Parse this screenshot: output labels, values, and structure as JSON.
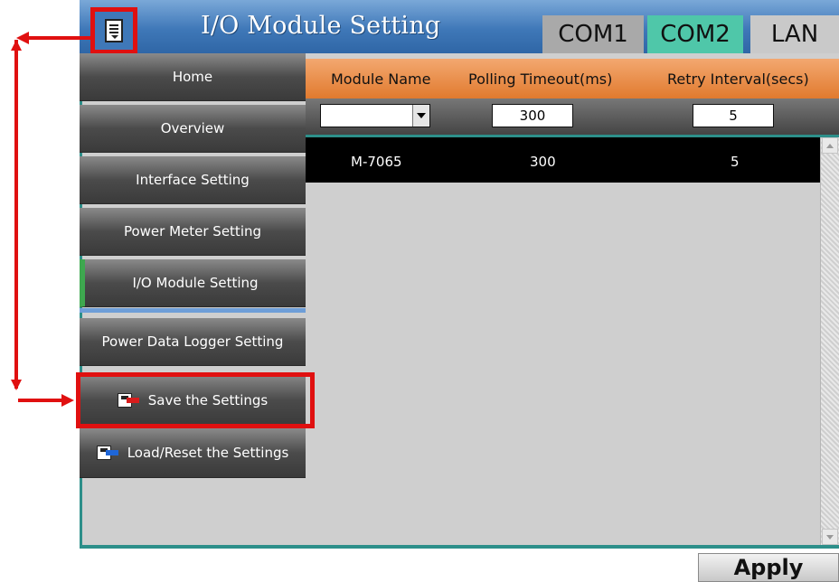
{
  "header": {
    "title": "I/O Module Setting",
    "menu_icon": "document-menu-icon",
    "tabs": [
      {
        "label": "COM1"
      },
      {
        "label": "COM2",
        "active": true
      },
      {
        "label": "LAN"
      }
    ]
  },
  "sidebar": {
    "items": [
      {
        "label": "Home"
      },
      {
        "label": "Overview"
      },
      {
        "label": "Interface Setting"
      },
      {
        "label": "Power Meter Setting"
      },
      {
        "label": "I/O Module Setting"
      },
      {
        "label": "Power Data Logger Setting"
      },
      {
        "label": "Save the Settings",
        "icon": "save-icon"
      },
      {
        "label": "Load/Reset the Settings",
        "icon": "load-icon"
      }
    ]
  },
  "table": {
    "columns": [
      "Module Name",
      "Polling Timeout(ms)",
      "Retry Interval(secs)"
    ],
    "inputs": {
      "module_name": "",
      "polling_timeout": "300",
      "retry_interval": "5"
    },
    "rows": [
      {
        "module_name": "M-7065",
        "polling_timeout": "300",
        "retry_interval": "5"
      }
    ]
  },
  "footer": {
    "apply_label": "Apply"
  },
  "colors": {
    "titlebar": "#3f78b8",
    "active_tab": "#4fc7a9",
    "column_header": "#e17a2e",
    "annotation": "#e01010",
    "active_nav_marker": "#3ea84f"
  }
}
